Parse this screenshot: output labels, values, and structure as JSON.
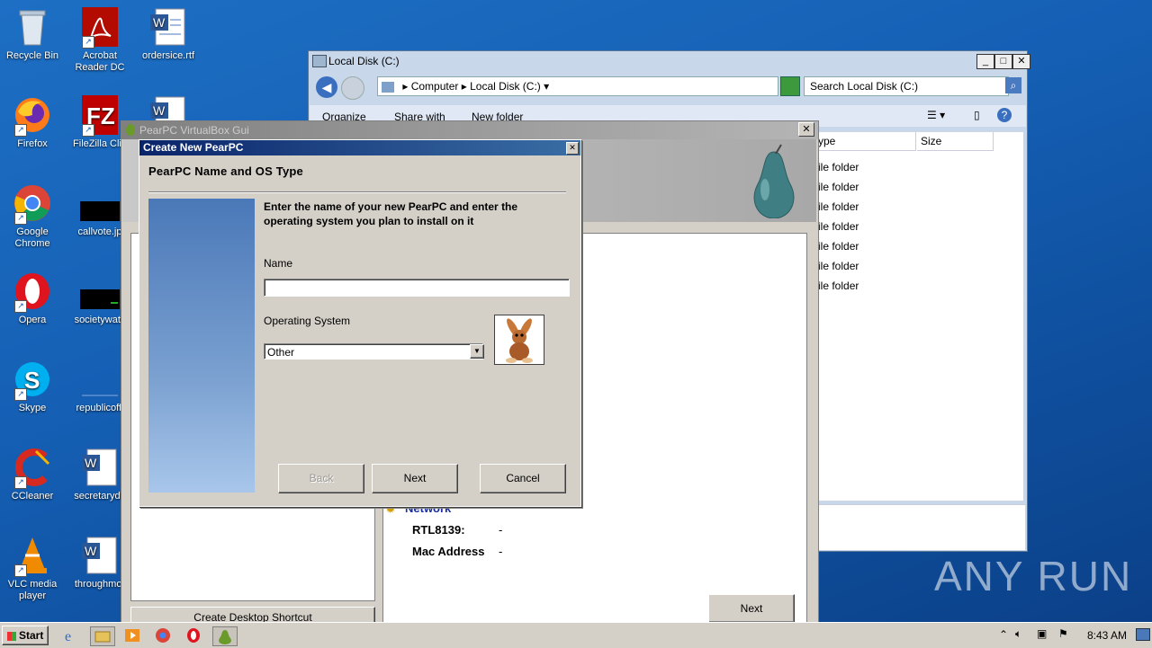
{
  "desktop": {
    "icons": [
      {
        "label": "Recycle Bin"
      },
      {
        "label": "Acrobat Reader DC"
      },
      {
        "label": "ordersice.rtf"
      },
      {
        "label": "Firefox"
      },
      {
        "label": "FileZilla Clie"
      },
      {
        "label": "Google Chrome"
      },
      {
        "label": "callvote.jp"
      },
      {
        "label": "Opera"
      },
      {
        "label": "societywatc"
      },
      {
        "label": "Skype"
      },
      {
        "label": "republicoffi"
      },
      {
        "label": "CCleaner"
      },
      {
        "label": "secretaryde"
      },
      {
        "label": "VLC media player"
      },
      {
        "label": "throughmor"
      }
    ]
  },
  "explorer": {
    "title": "Local Disk (C:)",
    "breadcrumb": [
      "Computer",
      "Local Disk (C:)"
    ],
    "search_placeholder": "Search Local Disk (C:)",
    "toolbar": {
      "organize": "Organize",
      "share": "Share with",
      "new_folder": "New folder"
    },
    "columns": {
      "type": "ype",
      "size": "Size"
    },
    "rows": [
      "ile folder",
      "ile folder",
      "ile folder",
      "ile folder",
      "ile folder",
      "ile folder",
      "ile folder"
    ]
  },
  "gui": {
    "title": "PearPC VirtualBox Gui",
    "network_label": "Network",
    "rtl_label": "RTL8139:",
    "rtl_value": "-",
    "mac_label": "Mac Address",
    "mac_value": "-",
    "next_label": "Next",
    "shortcut_label": "Create Desktop Shortcut"
  },
  "dialog": {
    "title": "Create New PearPC",
    "heading": "PearPC Name and OS Type",
    "instruction": "Enter the name of your new PearPC and enter the operating system you plan to install on it",
    "name_label": "Name",
    "name_value": "",
    "os_label": "Operating System",
    "os_value": "Other",
    "back_label": "Back",
    "next_label": "Next",
    "cancel_label": "Cancel"
  },
  "taskbar": {
    "start_label": "Start",
    "clock": "8:43 AM"
  },
  "watermark": "ANY RUN"
}
